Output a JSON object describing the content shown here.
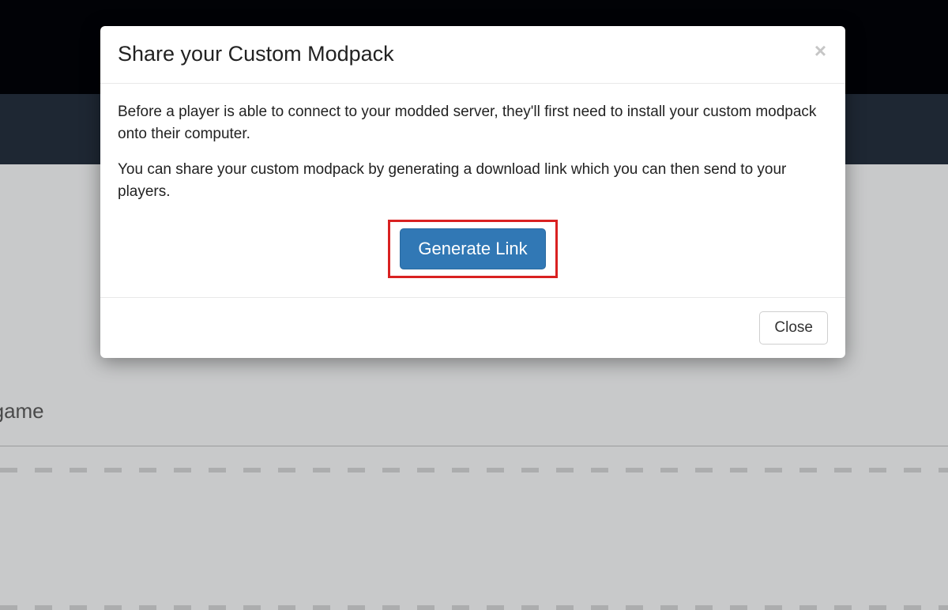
{
  "background": {
    "partial_text": "and game"
  },
  "modal": {
    "title": "Share your Custom Modpack",
    "close_icon": "×",
    "paragraph1": "Before a player is able to connect to your modded server, they'll first need to install your custom modpack onto their computer.",
    "paragraph2": "You can share your custom modpack by generating a download link which you can then send to your players.",
    "generate_button_label": "Generate Link",
    "footer_close_label": "Close"
  }
}
